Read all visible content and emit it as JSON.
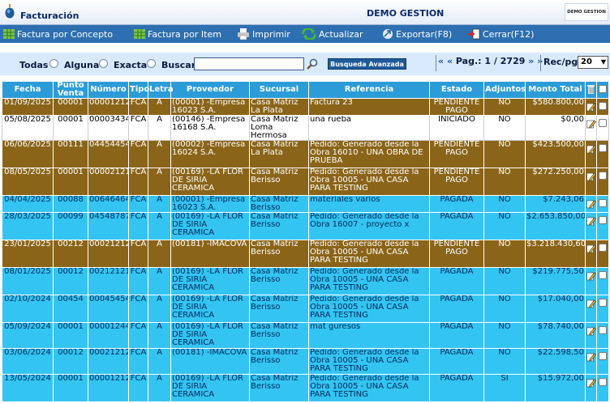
{
  "header": {
    "title": "Facturación",
    "company": "DEMO GESTION",
    "brand_text": "DEMO GESTION"
  },
  "toolbar": {
    "items": [
      {
        "label": "Factura por Concepto",
        "icon": "grid-icon"
      },
      {
        "label": "Factura por Item",
        "icon": "grid-icon"
      },
      {
        "label": "Imprimir",
        "icon": "printer-icon"
      },
      {
        "label": "Actualizar",
        "icon": "refresh-icon"
      },
      {
        "label": "Exportar(F8)",
        "icon": "export-icon"
      },
      {
        "label": "Cerrar(F12)",
        "icon": "exit-icon"
      }
    ]
  },
  "search": {
    "options": [
      "Todas",
      "Alguna",
      "Exacta",
      "Buscar"
    ],
    "value": "",
    "advanced_label": "Busqueda Avanzada"
  },
  "pager": {
    "first": "«",
    "prev": "«",
    "label": "Pag.:",
    "page": "1",
    "of": "/",
    "total": "2729",
    "next": "»",
    "last": "»",
    "recpg_label": "Rec/pg:",
    "recpg_value": "20"
  },
  "table": {
    "headers": [
      "Fecha",
      "Punto Venta",
      "Número",
      "Tipo",
      "Letra",
      "Proveedor",
      "Sucursal",
      "Referencia",
      "Estado",
      "Adjuntos",
      "Monto Total"
    ],
    "rows": [
      {
        "style": "brown",
        "cells": [
          "01/09/2025",
          "00001",
          "00001212",
          "FCA",
          "A",
          "(00001) -Empresa 16023 S.A.",
          "Casa Matriz La Plata",
          "Factura 23",
          "PENDIENTE PAGO",
          "NO",
          "$580.800,00"
        ]
      },
      {
        "style": "white",
        "cells": [
          "05/08/2025",
          "00001",
          "00003434",
          "FCA",
          "A",
          "(00146) -Empresa 16168 S.A.",
          "Casa Matriz Loma Hermosa",
          "una rueba",
          "INICIADO",
          "NO",
          "$0,00"
        ]
      },
      {
        "style": "brown",
        "cells": [
          "06/06/2025",
          "00111",
          "04454454",
          "FCA",
          "A",
          "(00002) -Empresa 16024 S.A.",
          "Casa Matriz La Plata",
          "Pedido: Generado desde la Obra 16010 - UNA OBRA DE PRUEBA",
          "PENDIENTE PAGO",
          "NO",
          "$423.500,00"
        ]
      },
      {
        "style": "brown",
        "cells": [
          "08/05/2025",
          "00001",
          "00002121",
          "FCA",
          "A",
          "(00169) -LA FLOR DE SIRIA CERAMICA",
          "Casa Matriz Berisso",
          "Pedido: Generado desde la Obra 10005 - UNA CASA PARA TESTING",
          "PENDIENTE PAGO",
          "NO",
          "$272.250,00"
        ]
      },
      {
        "style": "blue",
        "cells": [
          "04/04/2025",
          "00088",
          "00646464",
          "FCA",
          "A",
          "(00001) -Empresa 16023 S.A.",
          "Casa Matriz Berisso",
          "materiales varios",
          "PAGADA",
          "NO",
          "$7.243,06"
        ]
      },
      {
        "style": "blue",
        "cells": [
          "28/03/2025",
          "00099",
          "04548787",
          "FCA",
          "A",
          "(00169) -LA FLOR DE SIRIA CERAMICA",
          "Casa Matriz Berisso",
          "Pedido: Generado desde la Obra 16007 - proyecto x",
          "PAGADA",
          "NO",
          "$2.653.850,00"
        ]
      },
      {
        "style": "brown",
        "cells": [
          "23/01/2025",
          "00212",
          "00021212",
          "FCA",
          "A",
          "(00181) -IMACOVA",
          "Casa Matriz Berisso",
          "Pedido: Generado desde la Obra 10005 - UNA CASA PARA TESTING",
          "PENDIENTE PAGO",
          "NO",
          "$3.218.430,60"
        ]
      },
      {
        "style": "blue",
        "cells": [
          "08/01/2025",
          "00012",
          "00212121",
          "FCA",
          "A",
          "(00169) -LA FLOR DE SIRIA CERAMICA",
          "Casa Matriz Berisso",
          "Pedido: Generado desde la Obra 10005 - UNA CASA PARA TESTING",
          "PAGADA",
          "NO",
          "$219.775,50"
        ]
      },
      {
        "style": "blue",
        "cells": [
          "02/10/2024",
          "00454",
          "00045454",
          "FCA",
          "A",
          "(00169) -LA FLOR DE SIRIA CERAMICA",
          "Casa Matriz Berisso",
          "Pedido: Generado desde la Obra 10005 - UNA CASA PARA TESTING",
          "PAGADA",
          "NO",
          "$17.040,00"
        ]
      },
      {
        "style": "blue",
        "cells": [
          "05/09/2024",
          "00001",
          "00001244",
          "FCA",
          "A",
          "(00169) -LA FLOR DE SIRIA CERAMICA",
          "Casa Matriz Berisso",
          "mat guresos",
          "PAGADA",
          "NO",
          "$78.740,00"
        ]
      },
      {
        "style": "blue",
        "cells": [
          "03/06/2024",
          "00012",
          "00021212",
          "FCA",
          "A",
          "(00181) -IMACOVA",
          "Casa Matriz Berisso",
          "Pedido: Generado desde la Obra 10005 - UNA CASA PARA TESTING",
          "PAGADA",
          "NO",
          "$22.598,50"
        ]
      },
      {
        "style": "blue",
        "cells": [
          "13/05/2024",
          "00001",
          "00001212",
          "FCA",
          "A",
          "(00169) -LA FLOR DE SIRIA CERAMICA",
          "Casa Matriz Berisso",
          "Pedido: Generado desde la Obra 10005 - UNA CASA PARA TESTING",
          "PAGADA",
          "SI",
          "$15.972,00"
        ]
      }
    ]
  },
  "colors": {
    "toolbar": "#2d6fb0",
    "header_row": "#2b9cd8",
    "pending_row": "#8a6418",
    "paid_row": "#33c4f2",
    "search_band": "#d8e9fb"
  }
}
